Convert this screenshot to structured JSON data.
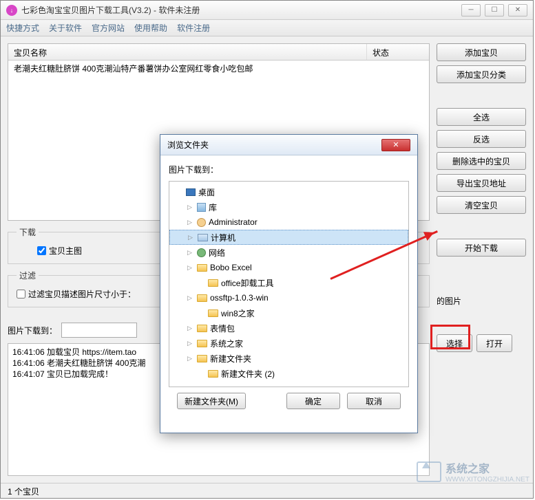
{
  "window": {
    "title": "七彩色淘宝宝贝图片下载工具(V3.2) - 软件未注册"
  },
  "menu": {
    "items": [
      "快捷方式",
      "关于软件",
      "官方网站",
      "使用帮助",
      "软件注册"
    ]
  },
  "grid": {
    "col_name": "宝贝名称",
    "col_status": "状态",
    "row1": "老潮夫红糖肚脐饼 400克潮汕特产番薯饼办公室网红零食小吃包邮"
  },
  "sidebar": {
    "add_item": "添加宝贝",
    "add_category": "添加宝贝分类",
    "select_all": "全选",
    "invert": "反选",
    "delete_selected": "删除选中的宝贝",
    "export_url": "导出宝贝地址",
    "clear": "清空宝贝",
    "start": "开始下载"
  },
  "download_group": {
    "legend": "下载",
    "checkbox_main": "宝贝主图"
  },
  "filter_group": {
    "legend": "过滤",
    "label": "过滤宝贝描述图片尺寸小于："
  },
  "pics_row": {
    "label_suffix": "的图片"
  },
  "path_row": {
    "label": "图片下载到：",
    "choose": "选择",
    "open": "打开"
  },
  "log": {
    "l1": "16:41:06 加载宝贝 https://item.tao",
    "l2": "16:41:06 老潮夫红糖肚脐饼 400克潮",
    "l3": "16:41:07 宝贝已加载完成！"
  },
  "status": {
    "text": "1 个宝贝"
  },
  "modal": {
    "title": "浏览文件夹",
    "prompt": "图片下载到：",
    "tree": {
      "desktop": "桌面",
      "lib": "库",
      "admin": "Administrator",
      "computer": "计算机",
      "network": "网络",
      "bobo": "Bobo Excel",
      "office": "office卸载工具",
      "ossftp": "ossftp-1.0.3-win",
      "win8": "win8之家",
      "emoji": "表情包",
      "xitong": "系统之家",
      "newf1": "新建文件夹",
      "newf2": "新建文件夹 (2)"
    },
    "new_folder": "新建文件夹(M)",
    "ok": "确定",
    "cancel": "取消"
  },
  "watermark": {
    "main": "系统之家",
    "sub": "WWW.XITONGZHIJIA.NET"
  }
}
